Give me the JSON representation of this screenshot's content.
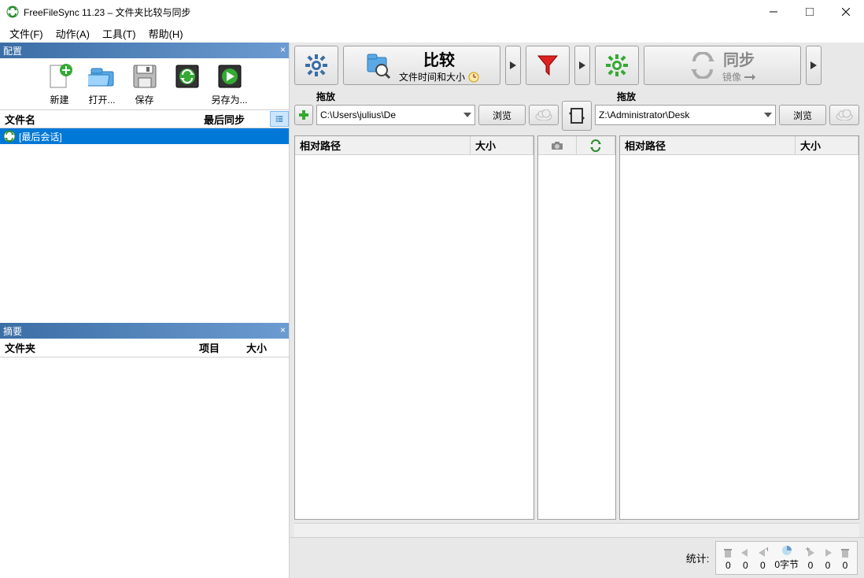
{
  "titlebar": {
    "title": "FreeFileSync 11.23 – 文件夹比较与同步"
  },
  "menu": {
    "file": "文件(F)",
    "action": "动作(A)",
    "tools": "工具(T)",
    "help": "帮助(H)"
  },
  "config": {
    "panel_title": "配置",
    "new": "新建",
    "open": "打开...",
    "save": "保存",
    "saveas": "另存为...",
    "filename_col": "文件名",
    "lastsync_col": "最后同步",
    "last_session": "[最后会话]"
  },
  "summary": {
    "panel_title": "摘要",
    "folder_col": "文件夹",
    "items_col": "项目",
    "size_col": "大小"
  },
  "toolbar": {
    "compare": "比较",
    "compare_sub": "文件时间和大小",
    "sync": "同步",
    "sync_sub": "镜像"
  },
  "pair": {
    "drag_left": "拖放",
    "drag_right": "拖放",
    "path_left": "C:\\Users\\julius\\De",
    "path_right": "Z:\\Administrator\\Desk",
    "browse": "浏览"
  },
  "grid": {
    "relpath": "相对路径",
    "size": "大小"
  },
  "status": {
    "label": "统计:",
    "vals": [
      "0",
      "0",
      "0",
      "0字节",
      "0",
      "0",
      "0"
    ]
  }
}
